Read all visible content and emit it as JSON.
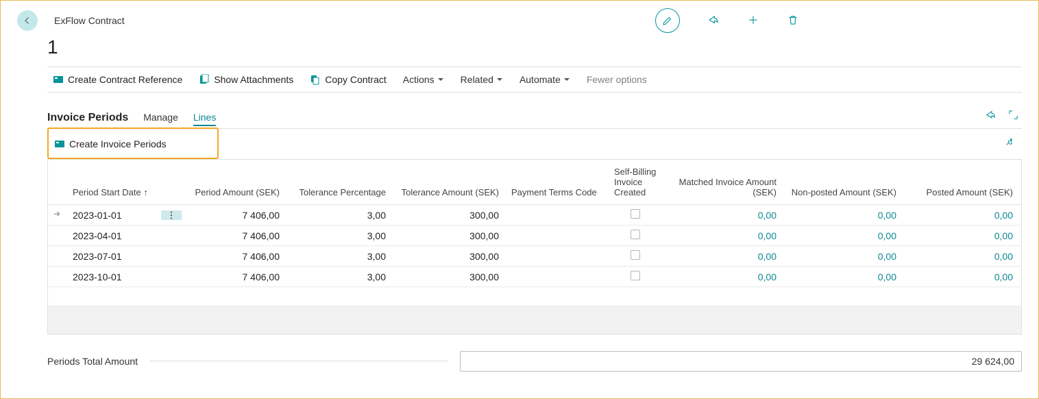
{
  "header": {
    "title": "ExFlow Contract",
    "record_no": "1"
  },
  "toolbar": {
    "create_ref": "Create Contract Reference",
    "show_attach": "Show Attachments",
    "copy": "Copy Contract",
    "actions": "Actions",
    "related": "Related",
    "automate": "Automate",
    "fewer": "Fewer options"
  },
  "section": {
    "title": "Invoice Periods",
    "tab_manage": "Manage",
    "tab_lines": "Lines"
  },
  "subtoolbar": {
    "create_periods": "Create Invoice Periods"
  },
  "table": {
    "columns": {
      "start": "Period Start Date ↑",
      "amount": "Period Amount (SEK)",
      "tol_pct": "Tolerance Percentage",
      "tol_amt": "Tolerance Amount (SEK)",
      "pay_terms": "Payment Terms Code",
      "self_bill": "Self-Billing Invoice Created",
      "matched": "Matched Invoice Amount (SEK)",
      "nonposted": "Non-posted Amount (SEK)",
      "posted": "Posted Amount (SEK)"
    },
    "rows": [
      {
        "start": "2023-01-01",
        "amount": "7 406,00",
        "tol_pct": "3,00",
        "tol_amt": "300,00",
        "pay_terms": "",
        "self_bill": false,
        "matched": "0,00",
        "nonposted": "0,00",
        "posted": "0,00",
        "selected": true
      },
      {
        "start": "2023-04-01",
        "amount": "7 406,00",
        "tol_pct": "3,00",
        "tol_amt": "300,00",
        "pay_terms": "",
        "self_bill": false,
        "matched": "0,00",
        "nonposted": "0,00",
        "posted": "0,00",
        "selected": false
      },
      {
        "start": "2023-07-01",
        "amount": "7 406,00",
        "tol_pct": "3,00",
        "tol_amt": "300,00",
        "pay_terms": "",
        "self_bill": false,
        "matched": "0,00",
        "nonposted": "0,00",
        "posted": "0,00",
        "selected": false
      },
      {
        "start": "2023-10-01",
        "amount": "7 406,00",
        "tol_pct": "3,00",
        "tol_amt": "300,00",
        "pay_terms": "",
        "self_bill": false,
        "matched": "0,00",
        "nonposted": "0,00",
        "posted": "0,00",
        "selected": false
      }
    ]
  },
  "footer": {
    "label": "Periods Total Amount",
    "value": "29 624,00"
  }
}
